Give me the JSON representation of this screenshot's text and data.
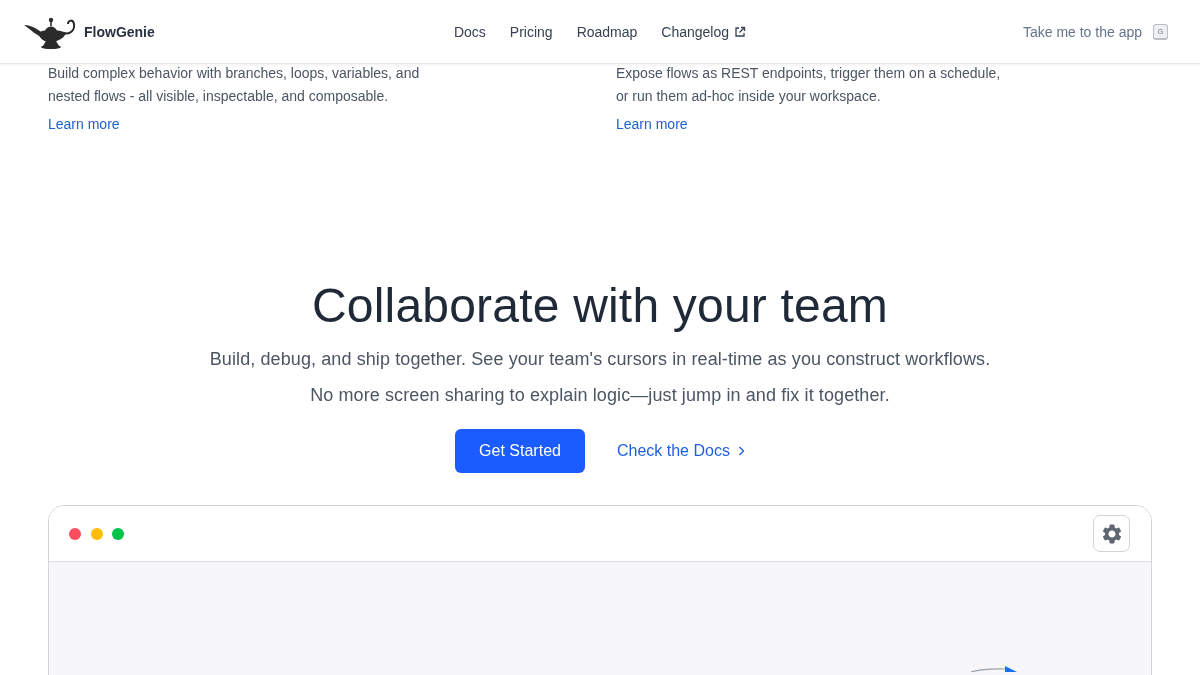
{
  "header": {
    "brand": "FlowGenie",
    "nav": [
      {
        "label": "Docs",
        "external": false
      },
      {
        "label": "Pricing",
        "external": false
      },
      {
        "label": "Roadmap",
        "external": false
      },
      {
        "label": "Changelog",
        "external": true
      }
    ],
    "app_link": {
      "label": "Take me to the app",
      "shortcut": "G"
    }
  },
  "features": [
    {
      "description": "Build complex behavior with branches, loops, variables, and nested flows - all visible, inspectable, and composable.",
      "link": "Learn more"
    },
    {
      "description": "Expose flows as REST endpoints, trigger them on a schedule, or run them ad-hoc inside your workspace.",
      "link": "Learn more"
    }
  ],
  "collaborate": {
    "title": "Collaborate with your team",
    "lines": [
      "Build, debug, and ship together. See your team's cursors in real-time as you construct workflows.",
      "No more screen sharing to explain logic—just jump in and fix it together."
    ],
    "primary_button": "Get Started",
    "secondary_link": "Check the Docs"
  },
  "preview": {
    "window_dots": [
      {
        "color": "#ff4d5e"
      },
      {
        "color": "#ffbd00"
      },
      {
        "color": "#00c244"
      }
    ]
  }
}
